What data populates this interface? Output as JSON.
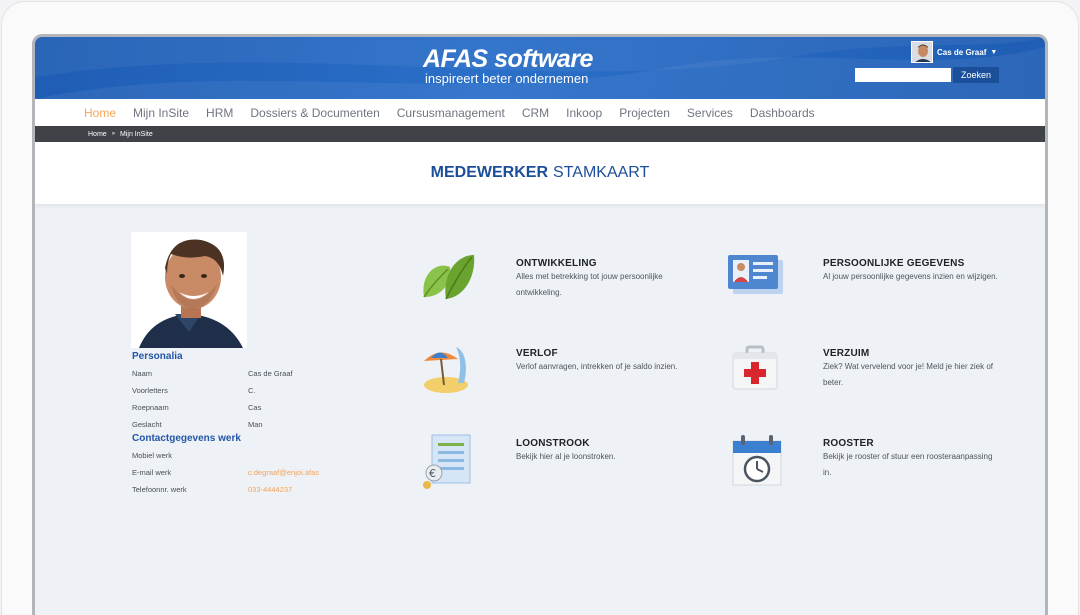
{
  "header": {
    "logo_name": "AFAS",
    "logo_software": "software",
    "tagline": "inspireert beter ondernemen",
    "user_name": "Cas de Graaf",
    "search_placeholder": "",
    "search_button": "Zoeken"
  },
  "nav": {
    "items": [
      "Home",
      "Mijn InSite",
      "HRM",
      "Dossiers & Documenten",
      "Cursusmanagement",
      "CRM",
      "Inkoop",
      "Projecten",
      "Services",
      "Dashboards"
    ]
  },
  "breadcrumb": {
    "home": "Home",
    "separator": "»",
    "current": "Mijn InSite"
  },
  "title": {
    "bold": "MEDEWERKER",
    "light": "STAMKAART"
  },
  "personalia": {
    "title": "Personalia",
    "fields": [
      {
        "label": "Naam",
        "value": "Cas de Graaf"
      },
      {
        "label": "Voorletters",
        "value": "C."
      },
      {
        "label": "Roepnaam",
        "value": "Cas"
      },
      {
        "label": "Geslacht",
        "value": "Man"
      }
    ]
  },
  "contact": {
    "title": "Contactgegevens werk",
    "fields": [
      {
        "label": "Mobiel werk",
        "value": ""
      },
      {
        "label": "E-mail werk",
        "value": "c.degraaf@enjoi.afas"
      },
      {
        "label": "Telefoonnr. werk",
        "value": "033-4444237"
      }
    ]
  },
  "tiles": [
    {
      "icon": "leaf-icon",
      "title": "ONTWIKKELING",
      "desc": "Alles met betrekking tot jouw persoonlijke ontwikkeling."
    },
    {
      "icon": "id-card-icon",
      "title": "PERSOONLIJKE GEGEVENS",
      "desc": "Al jouw persoonlijke gegevens inzien en wijzigen."
    },
    {
      "icon": "beach-umbrella-icon",
      "title": "VERLOF",
      "desc": "Verlof aanvragen, intrekken of je saldo inzien."
    },
    {
      "icon": "first-aid-kit-icon",
      "title": "VERZUIM",
      "desc": "Ziek? Wat vervelend voor je! Meld je hier ziek of beter."
    },
    {
      "icon": "payslip-icon",
      "title": "LOONSTROOK",
      "desc": "Bekijk hier al je loonstroken."
    },
    {
      "icon": "calendar-clock-icon",
      "title": "ROOSTER",
      "desc": "Bekijk je rooster of stuur een roosteraanpassing in."
    }
  ],
  "colors": {
    "brand_blue": "#1f5db4",
    "accent_orange": "#f3a55a",
    "dark_bar": "#3f4347",
    "heading_blue": "#1d4e9a"
  }
}
